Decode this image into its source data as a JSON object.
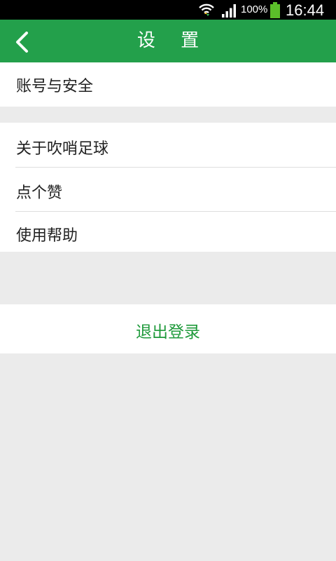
{
  "status_bar": {
    "battery_percent": "100%",
    "time": "16:44",
    "icons": [
      "wifi-icon",
      "signal-icon",
      "battery-icon"
    ]
  },
  "header": {
    "title": "设 置",
    "back_icon": "chevron-left-icon"
  },
  "sections": {
    "account": {
      "items": [
        {
          "label": "账号与安全"
        }
      ]
    },
    "info": {
      "items": [
        {
          "label": "关于吹哨足球"
        },
        {
          "label": "点个赞"
        },
        {
          "label": "使用帮助"
        }
      ]
    }
  },
  "logout": {
    "label": "退出登录"
  },
  "colors": {
    "brand_green": "#23a04b",
    "logout_text": "#1f9a3b",
    "background": "#ebebeb"
  }
}
